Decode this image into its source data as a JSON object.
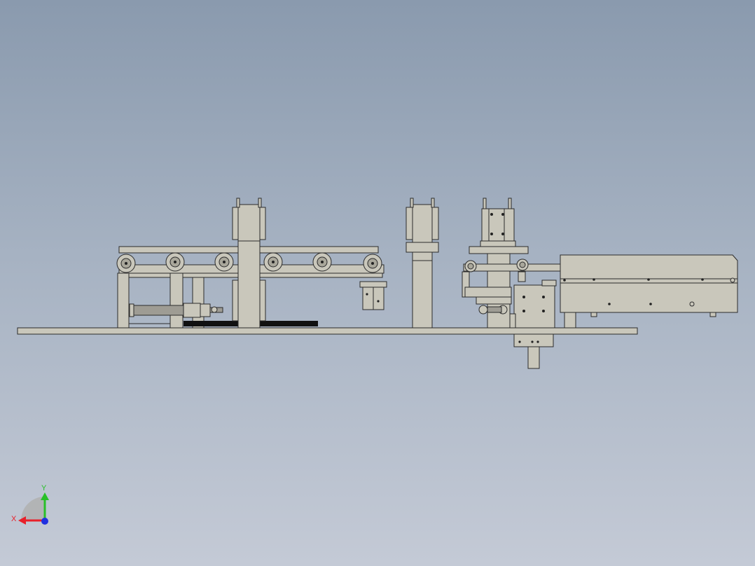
{
  "colors": {
    "background_top": "#8a9aae",
    "background_bottom": "#c4cad6",
    "part_fill": "#c9c7bb",
    "part_edge": "#2b2b2b",
    "axis_x": "#e8202a",
    "axis_y": "#28c028",
    "axis_z": "#2030e0"
  },
  "triad": {
    "x_label": "X",
    "y_label": "Y"
  }
}
